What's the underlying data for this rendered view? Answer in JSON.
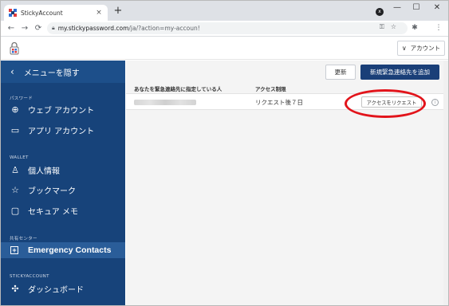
{
  "browser": {
    "tab_title": "StickyAccount",
    "tab_close": "×",
    "new_tab": "+",
    "profile_initial": "x",
    "window_controls": [
      "—",
      "☐",
      "✕"
    ],
    "url_host": "my.stickypassword.com",
    "url_path": "/ja/?action=my-accoun!",
    "nav": {
      "back": "←",
      "forward": "→",
      "reload": "⟳"
    }
  },
  "header": {
    "account_label": "アカウント",
    "account_chevron": "∨"
  },
  "sidebar": {
    "hide_menu": "メニューを隠す",
    "sections": {
      "passwords": "パスワード",
      "wallet": "WALLET",
      "sharing": "共有センター",
      "stickyaccount": "STICKYACCOUNT"
    },
    "items": [
      {
        "label": "ウェブ アカウント",
        "icon": "globe-icon"
      },
      {
        "label": "アプリ アカウント",
        "icon": "laptop-icon"
      },
      {
        "label": "個人情報",
        "icon": "person-icon"
      },
      {
        "label": "ブックマーク",
        "icon": "star-icon"
      },
      {
        "label": "セキュア メモ",
        "icon": "note-icon"
      },
      {
        "label": "Emergency Contacts",
        "icon": "plus-box-icon",
        "active": true
      },
      {
        "label": "ダッシュボード",
        "icon": "dashboard-icon"
      }
    ]
  },
  "main": {
    "refresh_button": "更新",
    "add_button": "新規緊急連絡先を追加",
    "columns": [
      "あなたを緊急連絡先に指定している人",
      "アクセス制限"
    ],
    "rows": [
      {
        "name": "",
        "access": "リクエスト後７日",
        "action": "アクセスをリクエスト"
      }
    ]
  },
  "colors": {
    "sidebar_bg": "#17437a",
    "primary_button": "#1a3f78",
    "highlight": "#e2141b"
  }
}
